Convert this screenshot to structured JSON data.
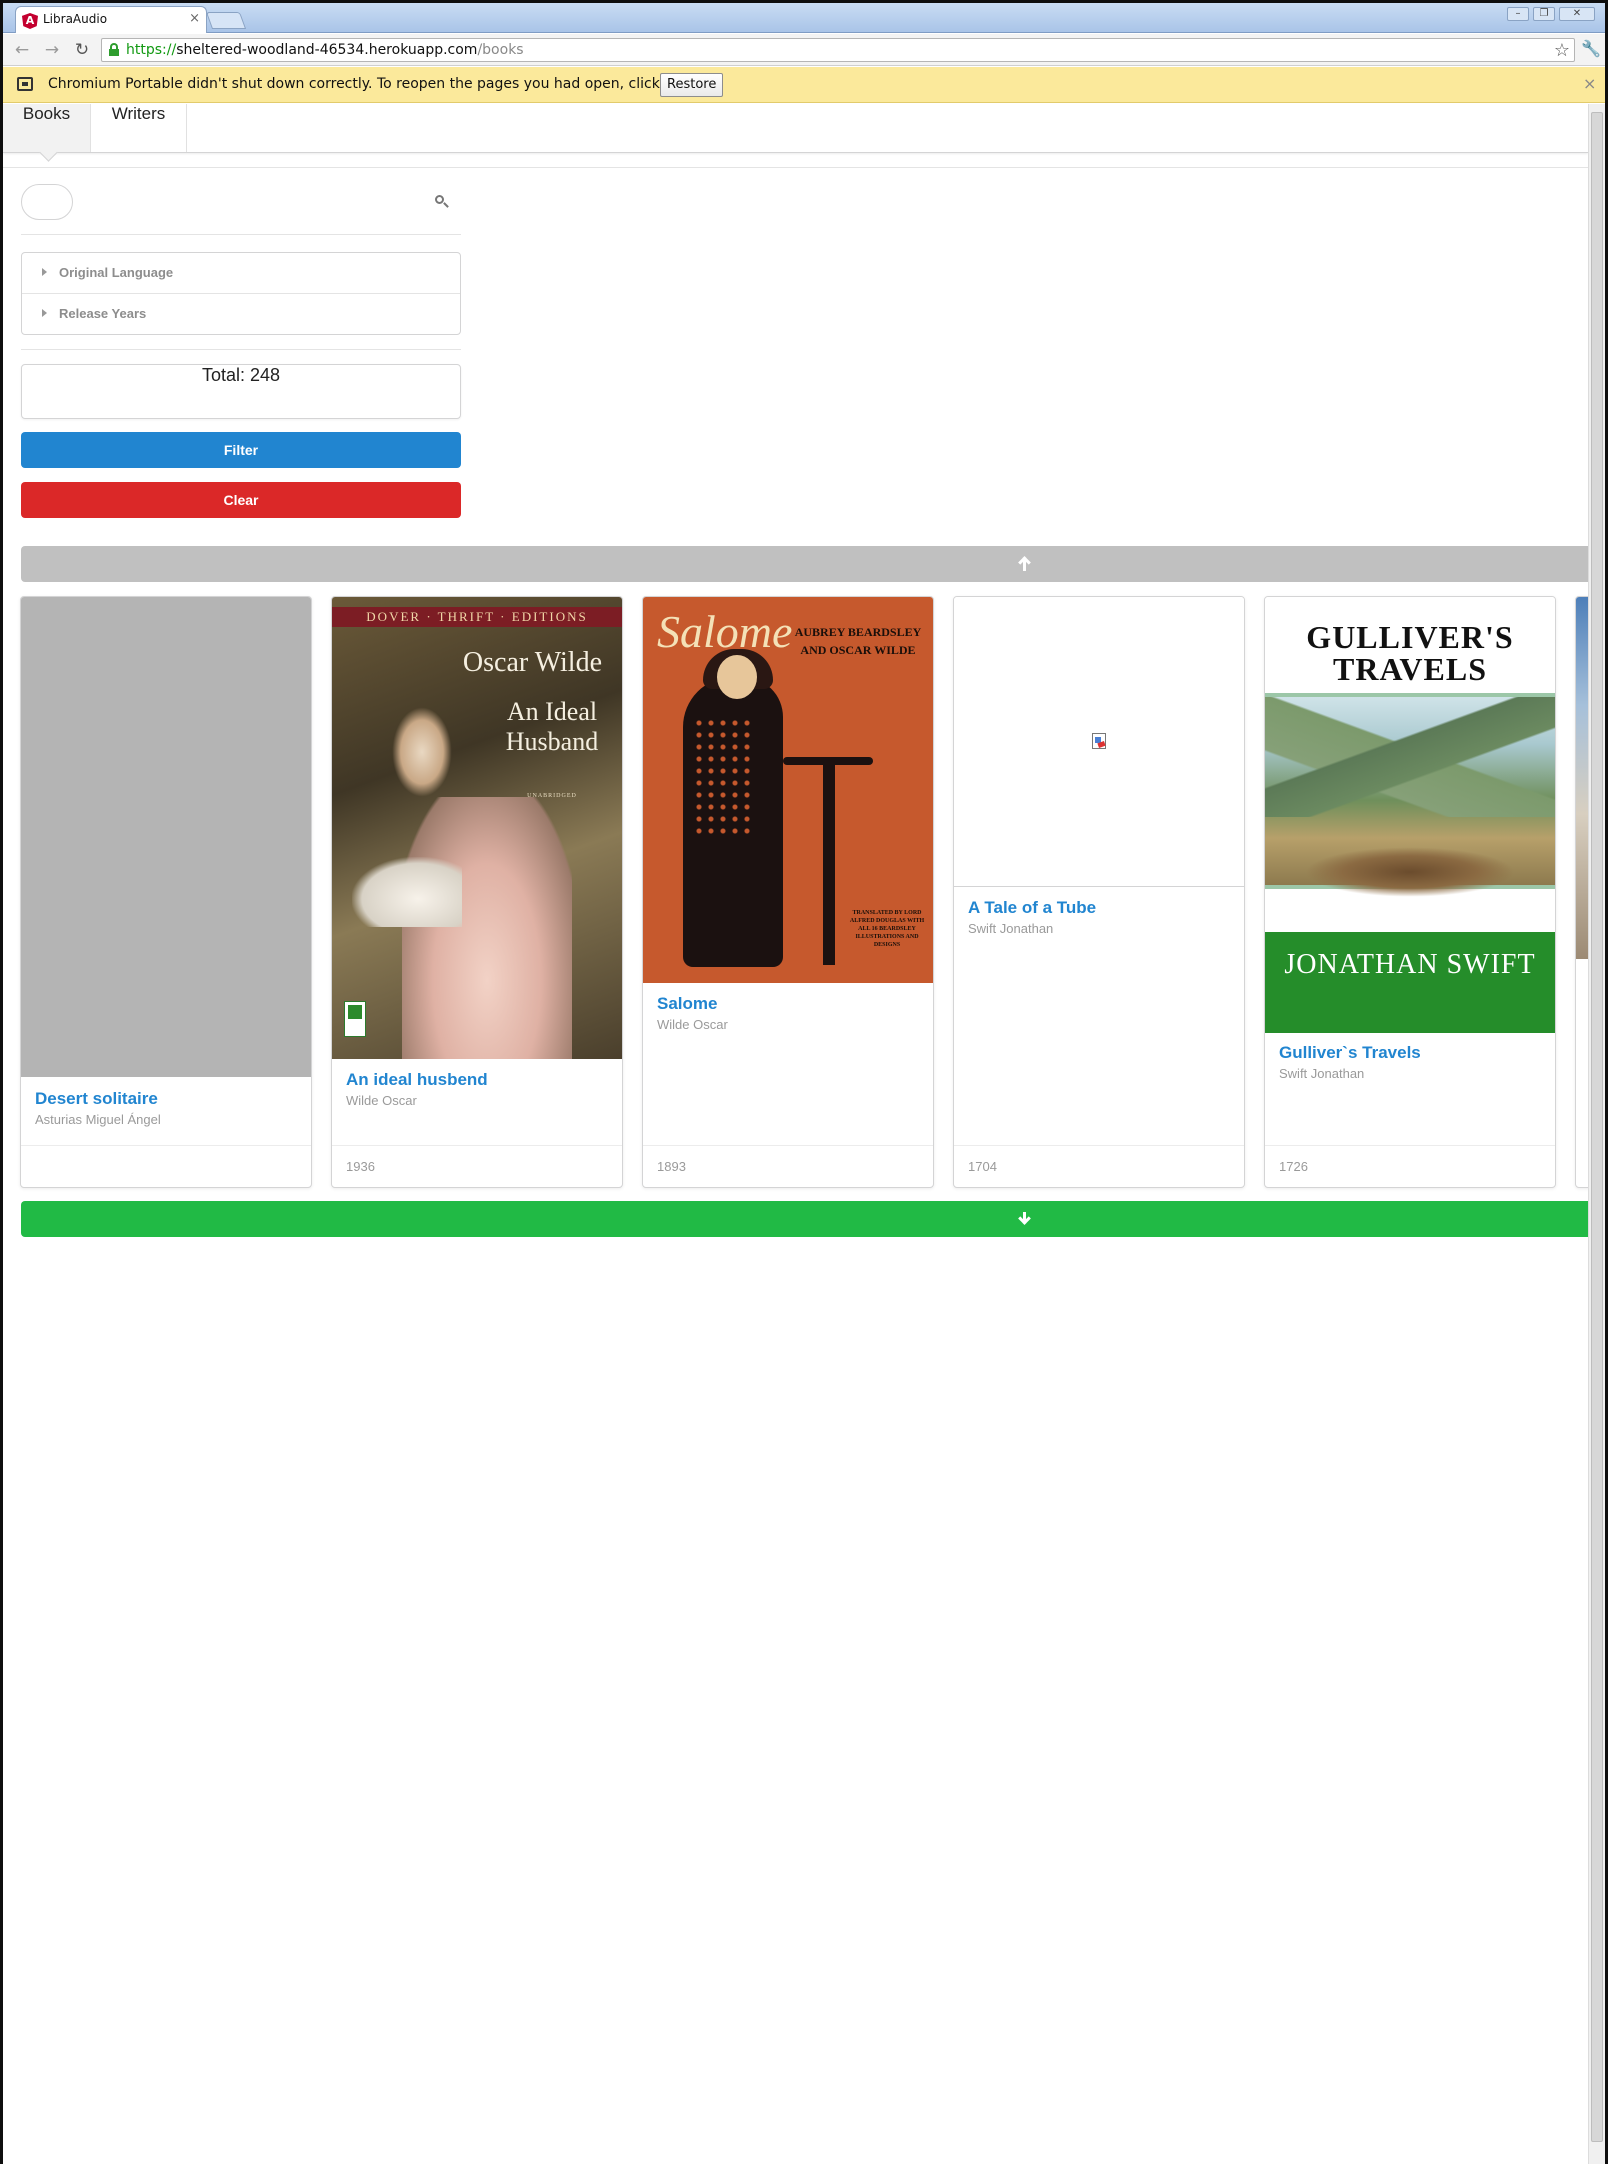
{
  "browser": {
    "tab_title": "LibraAudio",
    "tab_favicon": "A",
    "tab_close": "×",
    "url_scheme": "https://",
    "url_host": "sheltered-woodland-46534.herokuapp.com",
    "url_path": "/books",
    "infobar_text": "Chromium Portable didn't shut down correctly. To reopen the pages you had open, click Restore.",
    "restore_label": "Restore",
    "infobar_close": "×"
  },
  "menu": {
    "items": [
      {
        "label": "Books",
        "active": true
      },
      {
        "label": "Writers",
        "active": false
      }
    ]
  },
  "sidebar": {
    "search_value": "",
    "accordion": [
      {
        "label": "Original Language"
      },
      {
        "label": "Release Years"
      }
    ],
    "total": "Total: 248",
    "filter_label": "Filter",
    "clear_label": "Clear"
  },
  "books": [
    {
      "title": "Desert solitaire",
      "author": "Asturias Miguel Ángel",
      "year": "",
      "cover": "placeholder"
    },
    {
      "title": "An ideal husbend",
      "author": "Wilde Oscar",
      "year": "1936",
      "cover": "an-ideal-husband-cover",
      "cover_text": {
        "banner": "DOVER · THRIFT · EDITIONS",
        "author": "Oscar Wilde",
        "title": "An Ideal Husband",
        "sub": "UNABRIDGED"
      }
    },
    {
      "title": "Salome",
      "author": "Wilde Oscar",
      "year": "1893",
      "cover": "salome-cover",
      "cover_text": {
        "title": "Salome",
        "author": "AUBREY BEARDSLEY AND OSCAR WILDE",
        "credit": "TRANSLATED BY LORD ALFRED DOUGLAS WITH ALL 16 BEARDSLEY ILLUSTRATIONS AND DESIGNS"
      }
    },
    {
      "title": "A Tale of a Tube",
      "author": "Swift Jonathan",
      "year": "1704",
      "cover": "broken-image"
    },
    {
      "title": "Gulliver`s Travels",
      "author": "Swift Jonathan",
      "year": "1726",
      "cover": "gullivers-travels-cover",
      "cover_text": {
        "title": "GULLIVER'S TRAVELS",
        "author": "JONATHAN SWIFT"
      }
    }
  ],
  "colors": {
    "accent": "#2185d0",
    "danger": "#db2828",
    "success": "#21ba45",
    "disabled": "#c0c0c0",
    "infobar": "#fbe99b"
  },
  "icons": {
    "prev": "arrow-up-icon",
    "next": "arrow-down-icon",
    "search": "search-icon",
    "bookmark": "star-icon",
    "settings": "wrench-icon"
  }
}
